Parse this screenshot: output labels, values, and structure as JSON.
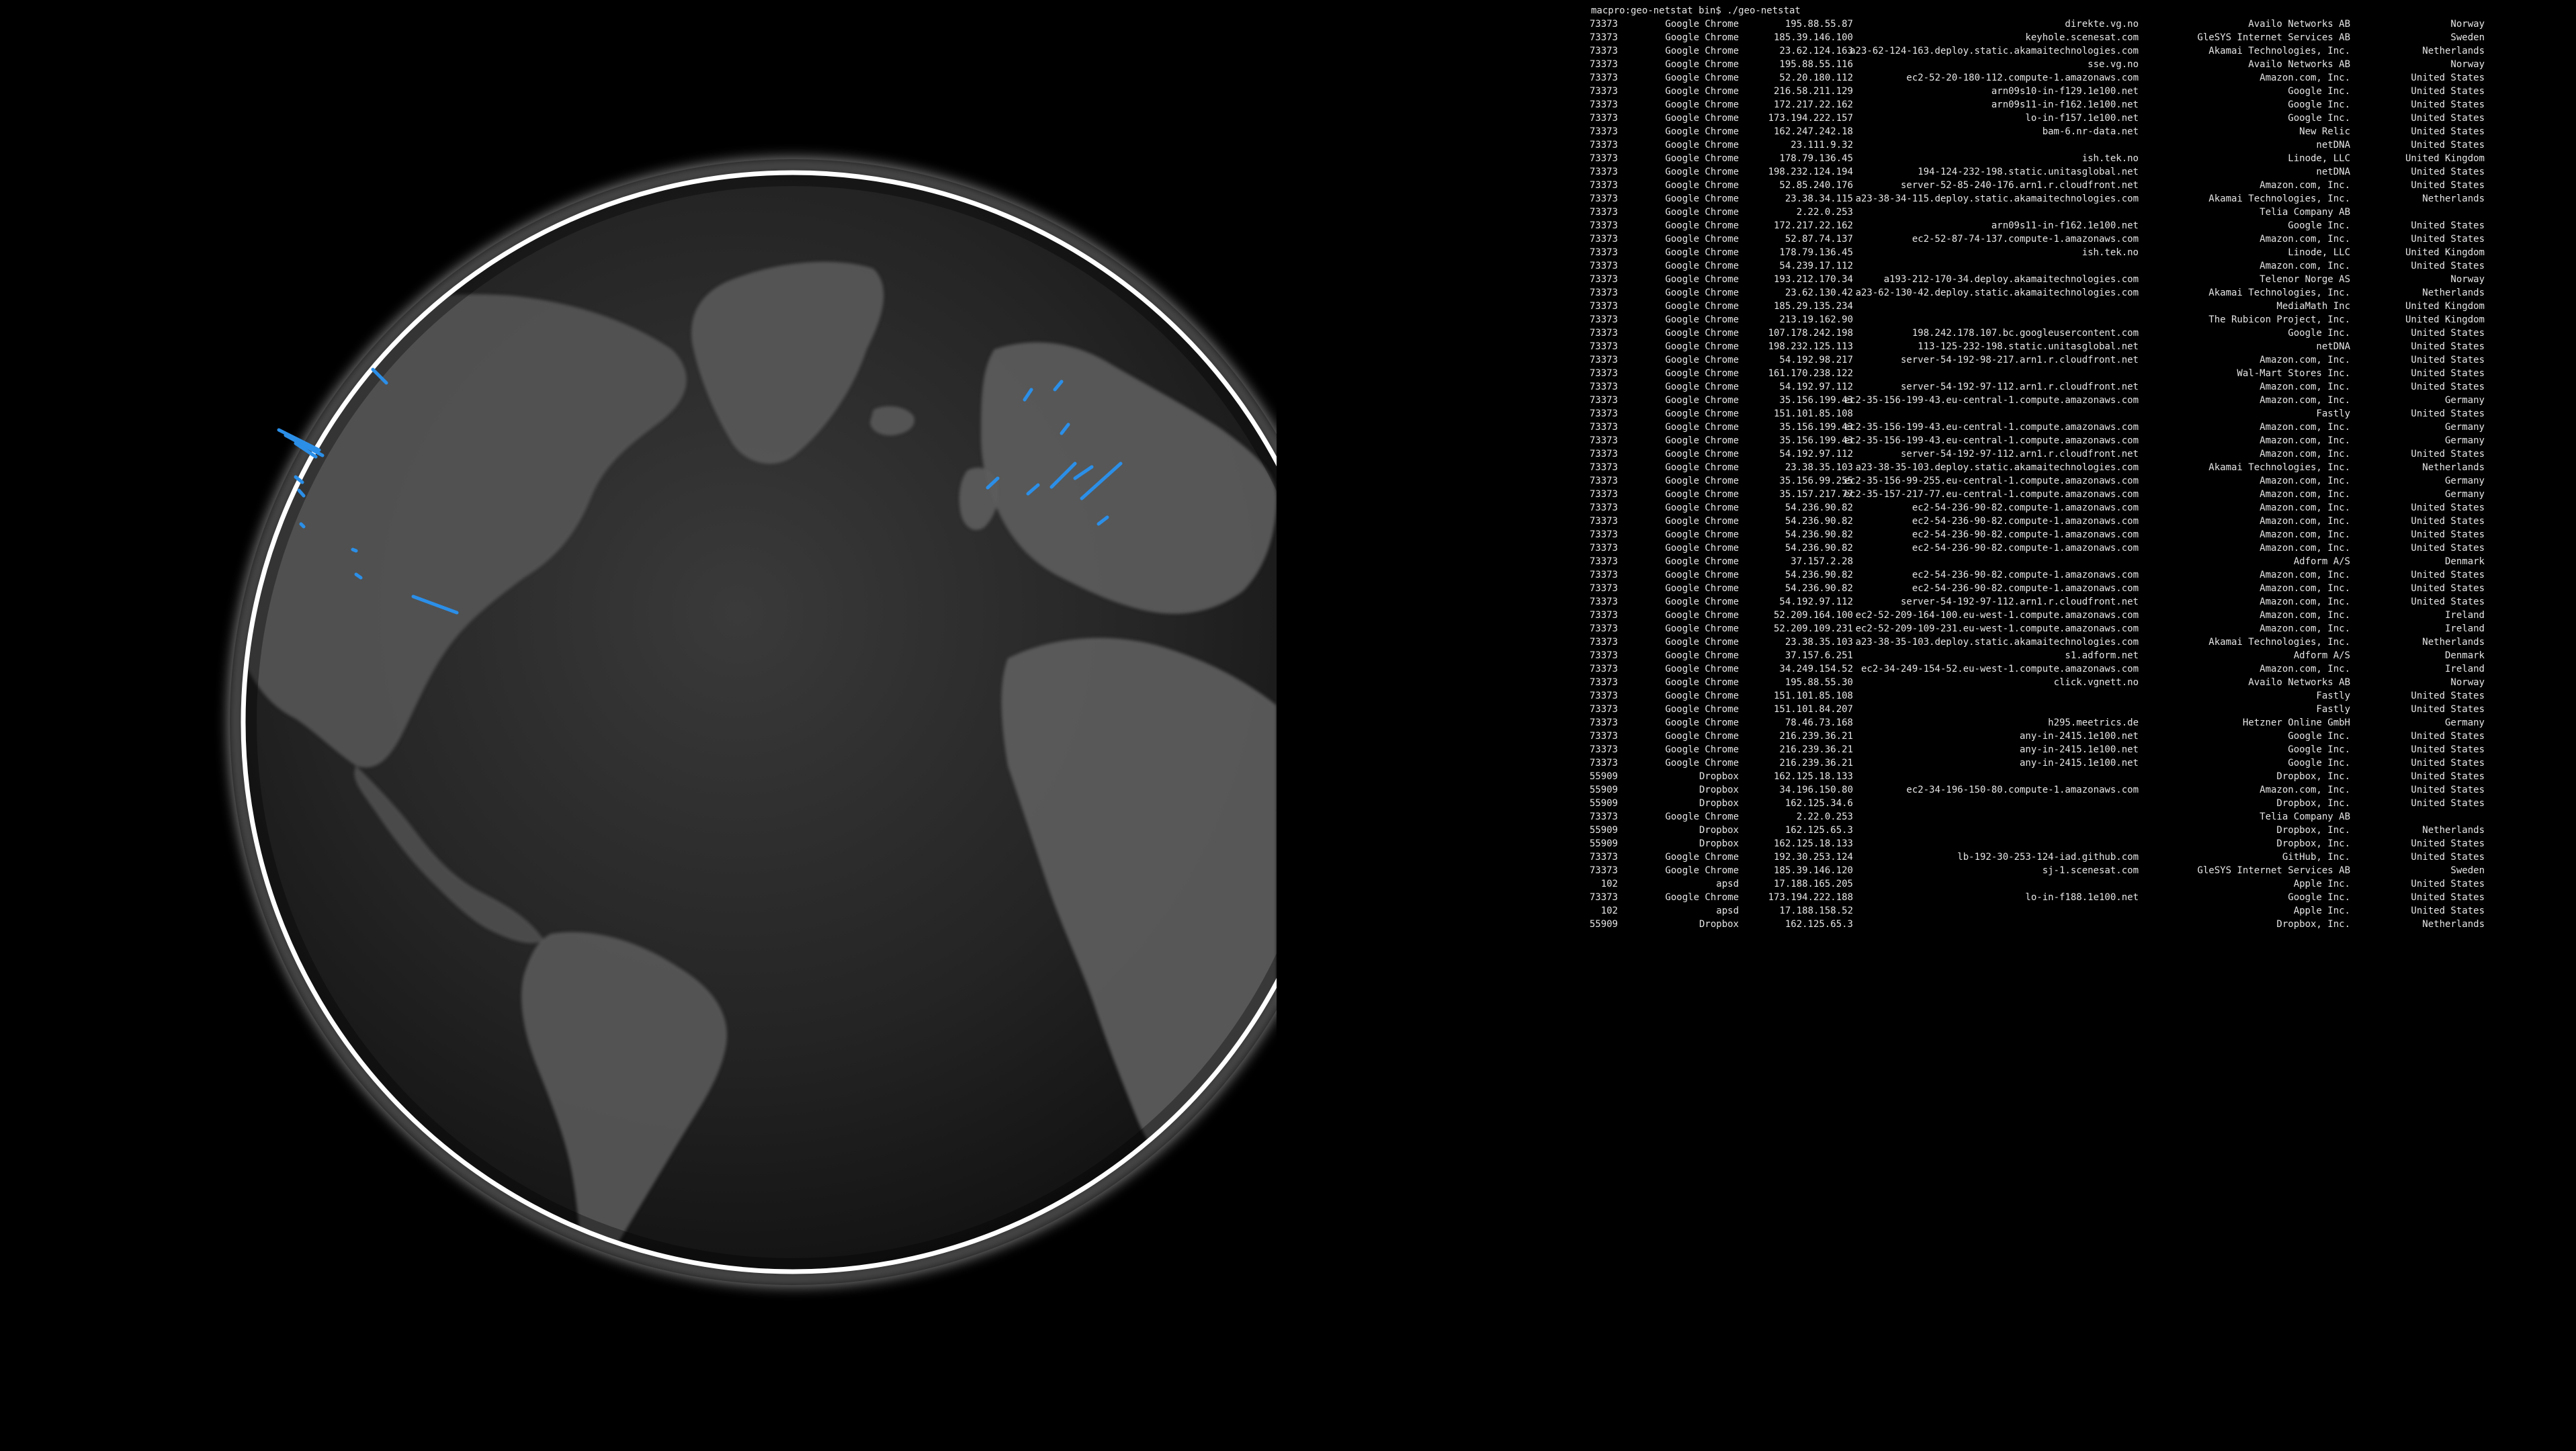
{
  "terminal": {
    "prompt": "macpro:geo-netstat bin$ ./geo-netstat",
    "rows": [
      {
        "pid": "73373",
        "process": "Google Chrome",
        "ip": "195.88.55.87",
        "host": "direkte.vg.no",
        "org": "Availo Networks AB",
        "country": "Norway"
      },
      {
        "pid": "73373",
        "process": "Google Chrome",
        "ip": "185.39.146.100",
        "host": "keyhole.scenesat.com",
        "org": "GleSYS Internet Services AB",
        "country": "Sweden"
      },
      {
        "pid": "73373",
        "process": "Google Chrome",
        "ip": "23.62.124.163",
        "host": "a23-62-124-163.deploy.static.akamaitechnologies.com",
        "org": "Akamai Technologies, Inc.",
        "country": "Netherlands"
      },
      {
        "pid": "73373",
        "process": "Google Chrome",
        "ip": "195.88.55.116",
        "host": "sse.vg.no",
        "org": "Availo Networks AB",
        "country": "Norway"
      },
      {
        "pid": "73373",
        "process": "Google Chrome",
        "ip": "52.20.180.112",
        "host": "ec2-52-20-180-112.compute-1.amazonaws.com",
        "org": "Amazon.com, Inc.",
        "country": "United States"
      },
      {
        "pid": "73373",
        "process": "Google Chrome",
        "ip": "216.58.211.129",
        "host": "arn09s10-in-f129.1e100.net",
        "org": "Google Inc.",
        "country": "United States"
      },
      {
        "pid": "73373",
        "process": "Google Chrome",
        "ip": "172.217.22.162",
        "host": "arn09s11-in-f162.1e100.net",
        "org": "Google Inc.",
        "country": "United States"
      },
      {
        "pid": "73373",
        "process": "Google Chrome",
        "ip": "173.194.222.157",
        "host": "lo-in-f157.1e100.net",
        "org": "Google Inc.",
        "country": "United States"
      },
      {
        "pid": "73373",
        "process": "Google Chrome",
        "ip": "162.247.242.18",
        "host": "bam-6.nr-data.net",
        "org": "New Relic",
        "country": "United States"
      },
      {
        "pid": "73373",
        "process": "Google Chrome",
        "ip": "23.111.9.32",
        "host": "",
        "org": "netDNA",
        "country": "United States"
      },
      {
        "pid": "73373",
        "process": "Google Chrome",
        "ip": "178.79.136.45",
        "host": "ish.tek.no",
        "org": "Linode, LLC",
        "country": "United Kingdom"
      },
      {
        "pid": "73373",
        "process": "Google Chrome",
        "ip": "198.232.124.194",
        "host": "194-124-232-198.static.unitasglobal.net",
        "org": "netDNA",
        "country": "United States"
      },
      {
        "pid": "73373",
        "process": "Google Chrome",
        "ip": "52.85.240.176",
        "host": "server-52-85-240-176.arn1.r.cloudfront.net",
        "org": "Amazon.com, Inc.",
        "country": "United States"
      },
      {
        "pid": "73373",
        "process": "Google Chrome",
        "ip": "23.38.34.115",
        "host": "a23-38-34-115.deploy.static.akamaitechnologies.com",
        "org": "Akamai Technologies, Inc.",
        "country": "Netherlands"
      },
      {
        "pid": "73373",
        "process": "Google Chrome",
        "ip": "2.22.0.253",
        "host": "",
        "org": "Telia Company AB",
        "country": ""
      },
      {
        "pid": "73373",
        "process": "Google Chrome",
        "ip": "172.217.22.162",
        "host": "arn09s11-in-f162.1e100.net",
        "org": "Google Inc.",
        "country": "United States"
      },
      {
        "pid": "73373",
        "process": "Google Chrome",
        "ip": "52.87.74.137",
        "host": "ec2-52-87-74-137.compute-1.amazonaws.com",
        "org": "Amazon.com, Inc.",
        "country": "United States"
      },
      {
        "pid": "73373",
        "process": "Google Chrome",
        "ip": "178.79.136.45",
        "host": "ish.tek.no",
        "org": "Linode, LLC",
        "country": "United Kingdom"
      },
      {
        "pid": "73373",
        "process": "Google Chrome",
        "ip": "54.239.17.112",
        "host": "",
        "org": "Amazon.com, Inc.",
        "country": "United States"
      },
      {
        "pid": "73373",
        "process": "Google Chrome",
        "ip": "193.212.170.34",
        "host": "a193-212-170-34.deploy.akamaitechnologies.com",
        "org": "Telenor Norge AS",
        "country": "Norway"
      },
      {
        "pid": "73373",
        "process": "Google Chrome",
        "ip": "23.62.130.42",
        "host": "a23-62-130-42.deploy.static.akamaitechnologies.com",
        "org": "Akamai Technologies, Inc.",
        "country": "Netherlands"
      },
      {
        "pid": "73373",
        "process": "Google Chrome",
        "ip": "185.29.135.234",
        "host": "",
        "org": "MediaMath Inc",
        "country": "United Kingdom"
      },
      {
        "pid": "73373",
        "process": "Google Chrome",
        "ip": "213.19.162.90",
        "host": "",
        "org": "The Rubicon Project, Inc.",
        "country": "United Kingdom"
      },
      {
        "pid": "73373",
        "process": "Google Chrome",
        "ip": "107.178.242.198",
        "host": "198.242.178.107.bc.googleusercontent.com",
        "org": "Google Inc.",
        "country": "United States"
      },
      {
        "pid": "73373",
        "process": "Google Chrome",
        "ip": "198.232.125.113",
        "host": "113-125-232-198.static.unitasglobal.net",
        "org": "netDNA",
        "country": "United States"
      },
      {
        "pid": "73373",
        "process": "Google Chrome",
        "ip": "54.192.98.217",
        "host": "server-54-192-98-217.arn1.r.cloudfront.net",
        "org": "Amazon.com, Inc.",
        "country": "United States"
      },
      {
        "pid": "73373",
        "process": "Google Chrome",
        "ip": "161.170.238.122",
        "host": "",
        "org": "Wal-Mart Stores Inc.",
        "country": "United States"
      },
      {
        "pid": "73373",
        "process": "Google Chrome",
        "ip": "54.192.97.112",
        "host": "server-54-192-97-112.arn1.r.cloudfront.net",
        "org": "Amazon.com, Inc.",
        "country": "United States"
      },
      {
        "pid": "73373",
        "process": "Google Chrome",
        "ip": "35.156.199.43",
        "host": "ec2-35-156-199-43.eu-central-1.compute.amazonaws.com",
        "org": "Amazon.com, Inc.",
        "country": "Germany"
      },
      {
        "pid": "73373",
        "process": "Google Chrome",
        "ip": "151.101.85.108",
        "host": "",
        "org": "Fastly",
        "country": "United States"
      },
      {
        "pid": "73373",
        "process": "Google Chrome",
        "ip": "35.156.199.43",
        "host": "ec2-35-156-199-43.eu-central-1.compute.amazonaws.com",
        "org": "Amazon.com, Inc.",
        "country": "Germany"
      },
      {
        "pid": "73373",
        "process": "Google Chrome",
        "ip": "35.156.199.43",
        "host": "ec2-35-156-199-43.eu-central-1.compute.amazonaws.com",
        "org": "Amazon.com, Inc.",
        "country": "Germany"
      },
      {
        "pid": "73373",
        "process": "Google Chrome",
        "ip": "54.192.97.112",
        "host": "server-54-192-97-112.arn1.r.cloudfront.net",
        "org": "Amazon.com, Inc.",
        "country": "United States"
      },
      {
        "pid": "73373",
        "process": "Google Chrome",
        "ip": "23.38.35.103",
        "host": "a23-38-35-103.deploy.static.akamaitechnologies.com",
        "org": "Akamai Technologies, Inc.",
        "country": "Netherlands"
      },
      {
        "pid": "73373",
        "process": "Google Chrome",
        "ip": "35.156.99.255",
        "host": "ec2-35-156-99-255.eu-central-1.compute.amazonaws.com",
        "org": "Amazon.com, Inc.",
        "country": "Germany"
      },
      {
        "pid": "73373",
        "process": "Google Chrome",
        "ip": "35.157.217.77",
        "host": "ec2-35-157-217-77.eu-central-1.compute.amazonaws.com",
        "org": "Amazon.com, Inc.",
        "country": "Germany"
      },
      {
        "pid": "73373",
        "process": "Google Chrome",
        "ip": "54.236.90.82",
        "host": "ec2-54-236-90-82.compute-1.amazonaws.com",
        "org": "Amazon.com, Inc.",
        "country": "United States"
      },
      {
        "pid": "73373",
        "process": "Google Chrome",
        "ip": "54.236.90.82",
        "host": "ec2-54-236-90-82.compute-1.amazonaws.com",
        "org": "Amazon.com, Inc.",
        "country": "United States"
      },
      {
        "pid": "73373",
        "process": "Google Chrome",
        "ip": "54.236.90.82",
        "host": "ec2-54-236-90-82.compute-1.amazonaws.com",
        "org": "Amazon.com, Inc.",
        "country": "United States"
      },
      {
        "pid": "73373",
        "process": "Google Chrome",
        "ip": "54.236.90.82",
        "host": "ec2-54-236-90-82.compute-1.amazonaws.com",
        "org": "Amazon.com, Inc.",
        "country": "United States"
      },
      {
        "pid": "73373",
        "process": "Google Chrome",
        "ip": "37.157.2.28",
        "host": "",
        "org": "Adform A/S",
        "country": "Denmark"
      },
      {
        "pid": "73373",
        "process": "Google Chrome",
        "ip": "54.236.90.82",
        "host": "ec2-54-236-90-82.compute-1.amazonaws.com",
        "org": "Amazon.com, Inc.",
        "country": "United States"
      },
      {
        "pid": "73373",
        "process": "Google Chrome",
        "ip": "54.236.90.82",
        "host": "ec2-54-236-90-82.compute-1.amazonaws.com",
        "org": "Amazon.com, Inc.",
        "country": "United States"
      },
      {
        "pid": "73373",
        "process": "Google Chrome",
        "ip": "54.192.97.112",
        "host": "server-54-192-97-112.arn1.r.cloudfront.net",
        "org": "Amazon.com, Inc.",
        "country": "United States"
      },
      {
        "pid": "73373",
        "process": "Google Chrome",
        "ip": "52.209.164.100",
        "host": "ec2-52-209-164-100.eu-west-1.compute.amazonaws.com",
        "org": "Amazon.com, Inc.",
        "country": "Ireland"
      },
      {
        "pid": "73373",
        "process": "Google Chrome",
        "ip": "52.209.109.231",
        "host": "ec2-52-209-109-231.eu-west-1.compute.amazonaws.com",
        "org": "Amazon.com, Inc.",
        "country": "Ireland"
      },
      {
        "pid": "73373",
        "process": "Google Chrome",
        "ip": "23.38.35.103",
        "host": "a23-38-35-103.deploy.static.akamaitechnologies.com",
        "org": "Akamai Technologies, Inc.",
        "country": "Netherlands"
      },
      {
        "pid": "73373",
        "process": "Google Chrome",
        "ip": "37.157.6.251",
        "host": "s1.adform.net",
        "org": "Adform A/S",
        "country": "Denmark"
      },
      {
        "pid": "73373",
        "process": "Google Chrome",
        "ip": "34.249.154.52",
        "host": "ec2-34-249-154-52.eu-west-1.compute.amazonaws.com",
        "org": "Amazon.com, Inc.",
        "country": "Ireland"
      },
      {
        "pid": "73373",
        "process": "Google Chrome",
        "ip": "195.88.55.30",
        "host": "click.vgnett.no",
        "org": "Availo Networks AB",
        "country": "Norway"
      },
      {
        "pid": "73373",
        "process": "Google Chrome",
        "ip": "151.101.85.108",
        "host": "",
        "org": "Fastly",
        "country": "United States"
      },
      {
        "pid": "73373",
        "process": "Google Chrome",
        "ip": "151.101.84.207",
        "host": "",
        "org": "Fastly",
        "country": "United States"
      },
      {
        "pid": "73373",
        "process": "Google Chrome",
        "ip": "78.46.73.168",
        "host": "h295.meetrics.de",
        "org": "Hetzner Online GmbH",
        "country": "Germany"
      },
      {
        "pid": "73373",
        "process": "Google Chrome",
        "ip": "216.239.36.21",
        "host": "any-in-2415.1e100.net",
        "org": "Google Inc.",
        "country": "United States"
      },
      {
        "pid": "73373",
        "process": "Google Chrome",
        "ip": "216.239.36.21",
        "host": "any-in-2415.1e100.net",
        "org": "Google Inc.",
        "country": "United States"
      },
      {
        "pid": "73373",
        "process": "Google Chrome",
        "ip": "216.239.36.21",
        "host": "any-in-2415.1e100.net",
        "org": "Google Inc.",
        "country": "United States"
      },
      {
        "pid": "55909",
        "process": "Dropbox",
        "ip": "162.125.18.133",
        "host": "",
        "org": "Dropbox, Inc.",
        "country": "United States"
      },
      {
        "pid": "55909",
        "process": "Dropbox",
        "ip": "34.196.150.80",
        "host": "ec2-34-196-150-80.compute-1.amazonaws.com",
        "org": "Amazon.com, Inc.",
        "country": "United States"
      },
      {
        "pid": "55909",
        "process": "Dropbox",
        "ip": "162.125.34.6",
        "host": "",
        "org": "Dropbox, Inc.",
        "country": "United States"
      },
      {
        "pid": "73373",
        "process": "Google Chrome",
        "ip": "2.22.0.253",
        "host": "",
        "org": "Telia Company AB",
        "country": ""
      },
      {
        "pid": "55909",
        "process": "Dropbox",
        "ip": "162.125.65.3",
        "host": "",
        "org": "Dropbox, Inc.",
        "country": "Netherlands"
      },
      {
        "pid": "55909",
        "process": "Dropbox",
        "ip": "162.125.18.133",
        "host": "",
        "org": "Dropbox, Inc.",
        "country": "United States"
      },
      {
        "pid": "73373",
        "process": "Google Chrome",
        "ip": "192.30.253.124",
        "host": "lb-192-30-253-124-iad.github.com",
        "org": "GitHub, Inc.",
        "country": "United States"
      },
      {
        "pid": "73373",
        "process": "Google Chrome",
        "ip": "185.39.146.120",
        "host": "sj-1.scenesat.com",
        "org": "GleSYS Internet Services AB",
        "country": "Sweden"
      },
      {
        "pid": "102",
        "process": "apsd",
        "ip": "17.188.165.205",
        "host": "",
        "org": "Apple Inc.",
        "country": "United States"
      },
      {
        "pid": "73373",
        "process": "Google Chrome",
        "ip": "173.194.222.188",
        "host": "lo-in-f188.1e100.net",
        "org": "Google Inc.",
        "country": "United States"
      },
      {
        "pid": "102",
        "process": "apsd",
        "ip": "17.188.158.52",
        "host": "",
        "org": "Apple Inc.",
        "country": "United States"
      },
      {
        "pid": "55909",
        "process": "Dropbox",
        "ip": "162.125.65.3",
        "host": "",
        "org": "Dropbox, Inc.",
        "country": "Netherlands"
      }
    ]
  },
  "colors": {
    "background": "#000000",
    "text": "#e6e6e6",
    "connection": "#2b8fe8",
    "globe_rim": "#ffffff"
  }
}
